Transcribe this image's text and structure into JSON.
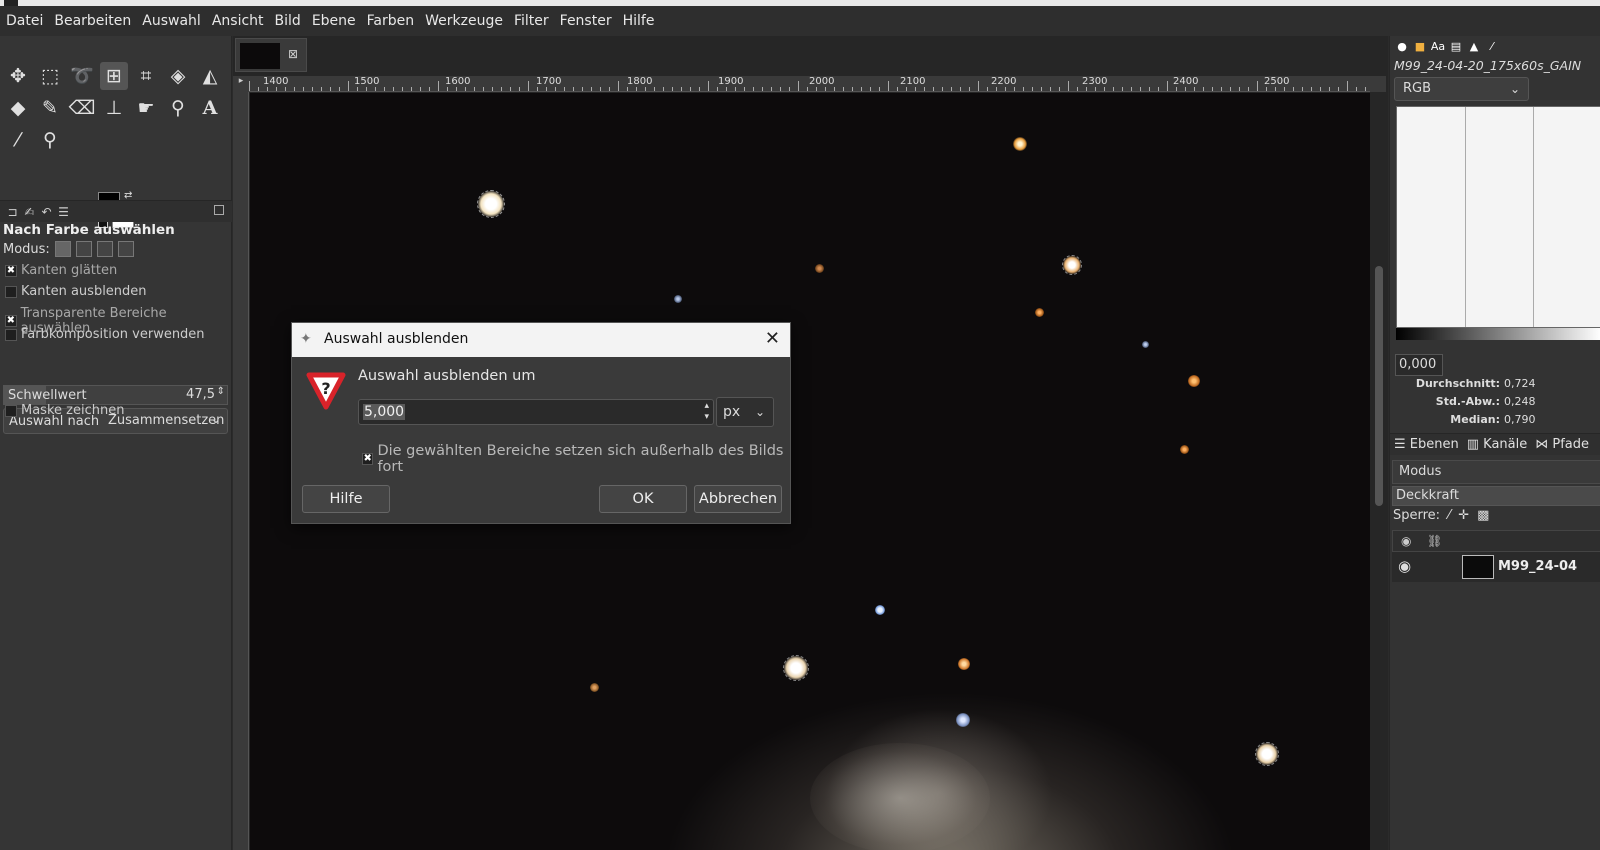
{
  "menu": [
    "Datei",
    "Bearbeiten",
    "Auswahl",
    "Ansicht",
    "Bild",
    "Ebene",
    "Farben",
    "Werkzeuge",
    "Filter",
    "Fenster",
    "Hilfe"
  ],
  "tool_options": {
    "title": "Nach Farbe auswählen",
    "mode_label": "Modus:",
    "antialias": "Kanten glätten",
    "feather": "Kanten ausblenden",
    "transparent": "Transparente Bereiche auswählen",
    "composite": "Farbkomposition verwenden",
    "threshold_label": "Schwellwert",
    "threshold_value": "47,5",
    "threshold_fraction": 0.19,
    "select_by_label": "Auswahl nach",
    "select_by_value": "Zusammensetzen",
    "draw_mask": "Maske zeichnen"
  },
  "ruler": [
    "1400",
    "1500",
    "1600",
    "1700",
    "1800",
    "1900",
    "2000",
    "2100",
    "2200",
    "2300",
    "2400",
    "2500"
  ],
  "histogram": {
    "title": "M99_24-04-20_175x60s_GAIN",
    "channel": "RGB",
    "range_low": "0,000",
    "mean_label": "Durchschnitt:",
    "mean_value": "0,724",
    "std_label": "Std.-Abw.:",
    "std_value": "0,248",
    "median_label": "Median:",
    "median_value": "0,790"
  },
  "layers": {
    "tab_layers": "Ebenen",
    "tab_channels": "Kanäle",
    "tab_paths": "Pfade",
    "mode": "Modus",
    "opacity": "Deckkraft",
    "lock": "Sperre:",
    "layer_name": "M99_24-04"
  },
  "dialog": {
    "title": "Auswahl ausblenden",
    "label": "Auswahl ausblenden um",
    "value": "5,000",
    "unit": "px",
    "edge_option": "Die gewählten Bereiche setzen sich außerhalb des Bilds fort",
    "help": "Hilfe",
    "ok": "OK",
    "cancel": "Abbrechen"
  },
  "colors": {
    "accent_warning": "#d8232a",
    "background": "#2b2b2b"
  }
}
